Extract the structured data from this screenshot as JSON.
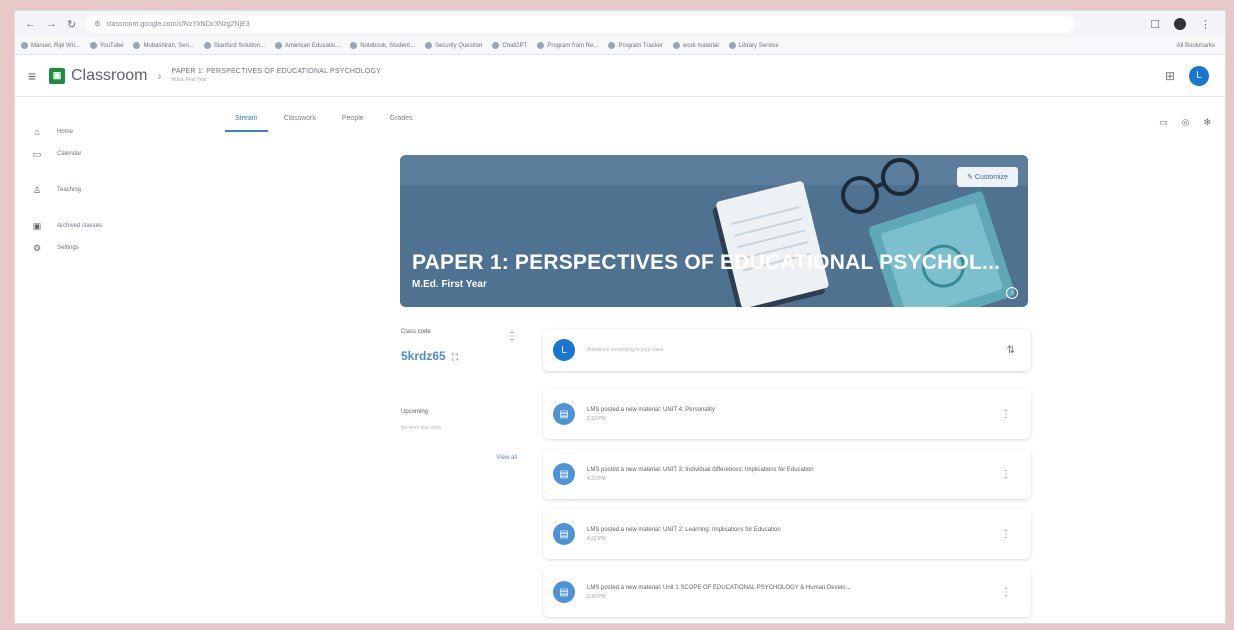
{
  "browser": {
    "nav_back": "←",
    "nav_forward": "→",
    "nav_reload": "↻",
    "url": "classroom.google.com/c/NzYxNDc3Nzg2NjE3",
    "bookmarks": [
      "Manuel, Ripi Wri...",
      "YouTube",
      "Mubashirah, Seri...",
      "Stanford Solution...",
      "American Educatio...",
      "Notebook, Student...",
      "Security Question",
      "ChatGPT",
      "Program from Re...",
      "Program Tracker",
      "work material",
      "Library Service"
    ],
    "all_bookmarks": "All Bookmarks"
  },
  "app": {
    "brand": "Classroom",
    "breadcrumb_title": "PAPER 1: PERSPECTIVES OF EDUCATIONAL PSYCHOLOGY",
    "breadcrumb_sub": "M.Ed. First Year",
    "avatar_letter": "L"
  },
  "tabs": [
    "Stream",
    "Classwork",
    "People",
    "Grades"
  ],
  "sidebar": {
    "items": [
      {
        "label": "Home",
        "icon": "home-icon"
      },
      {
        "label": "Calendar",
        "icon": "calendar-icon"
      },
      {
        "label": "Teaching",
        "icon": "people-icon"
      },
      {
        "label": "Archived classes",
        "icon": "archive-icon"
      },
      {
        "label": "Settings",
        "icon": "gear-icon"
      }
    ]
  },
  "banner": {
    "title": "PAPER 1: PERSPECTIVES OF EDUCATIONAL PSYCHOL...",
    "subtitle": "M.Ed. First Year",
    "customize_label": "Customize"
  },
  "class_code": {
    "label": "Class code",
    "code": "5krdz65"
  },
  "upcoming": {
    "title": "Upcoming",
    "sub": "No work due soon",
    "view_all": "View all"
  },
  "announce": {
    "placeholder": "Announce something to your class"
  },
  "posts": [
    {
      "title": "LMS posted a new material: UNIT 4: Personality",
      "time": "2:33 PM"
    },
    {
      "title": "LMS posted a new material: UNIT 3: Individual differences: Implications for Education",
      "time": "4:22 PM"
    },
    {
      "title": "LMS posted a new material: UNIT 2: Learning: Implications for Education",
      "time": "4:22 PM"
    },
    {
      "title": "LMS posted a new material: Unit 1 SCOPE OF EDUCATIONAL PSYCHOLOGY & Human Develo...",
      "time": "2:22 PM"
    }
  ],
  "colors": {
    "accent": "#3b82c4",
    "banner": "#4e7290",
    "classroom_green": "#1e8e3e",
    "avatar": "#1976d2"
  }
}
